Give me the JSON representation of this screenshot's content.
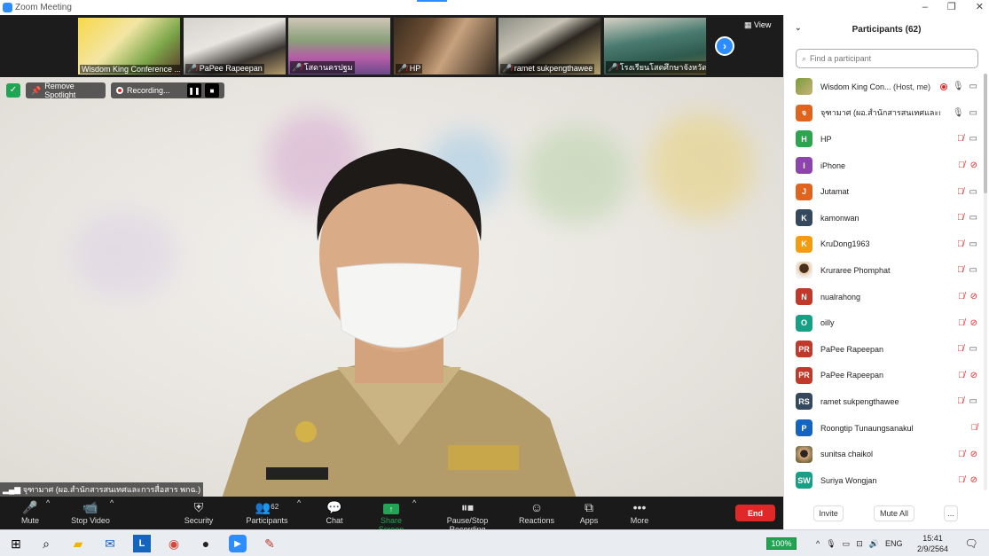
{
  "window": {
    "title": "Zoom Meeting",
    "controls": [
      "–",
      "❐",
      "✕"
    ]
  },
  "thumbnails": [
    {
      "name": "Wisdom King Conference ...",
      "muted": false
    },
    {
      "name": "PaPee Rapeepan",
      "muted": true
    },
    {
      "name": "โสดานครปฐม",
      "muted": true
    },
    {
      "name": "HP",
      "muted": true
    },
    {
      "name": "ramet  sukpengthawee",
      "muted": true
    },
    {
      "name": "โรงเรียนโสตศึกษาจังหวัดน...",
      "muted": true
    }
  ],
  "view_label": "View",
  "main": {
    "remove_spotlight": "Remove Spotlight",
    "recording_label": "Recording...",
    "speaker_name": "จุฑามาศ (ผอ.สำนักสารสนเทศและการสื่อสาร พกฉ.)"
  },
  "toolbar": {
    "mute": "Mute",
    "stop_video": "Stop Video",
    "security": "Security",
    "participants": "Participants",
    "participants_count": "62",
    "chat": "Chat",
    "share_screen": "Share Screen",
    "pause_stop_recording": "Pause/Stop Recording",
    "reactions": "Reactions",
    "apps": "Apps",
    "more": "More",
    "end": "End"
  },
  "panel": {
    "title": "Participants (62)",
    "search_placeholder": "Find a participant",
    "participants": [
      {
        "initials": "",
        "avatar": "img",
        "color": "#7a9d3a",
        "name": "Wisdom King Con...",
        "role": "(Host, me)",
        "recording": true,
        "mic": "on",
        "cam": "on"
      },
      {
        "initials": "จ",
        "avatar": "letter",
        "color": "#e0641e",
        "name": "จุฑามาศ (ผอ.สำนักสารสนเทศและการ...",
        "role": "",
        "recording": false,
        "mic": "on",
        "cam": "on"
      },
      {
        "initials": "H",
        "avatar": "letter",
        "color": "#2ea44f",
        "name": "HP",
        "role": "",
        "recording": false,
        "mic": "off",
        "cam": "on"
      },
      {
        "initials": "I",
        "avatar": "letter",
        "color": "#8e44ad",
        "name": "iPhone",
        "role": "",
        "recording": false,
        "mic": "off",
        "cam": "off"
      },
      {
        "initials": "J",
        "avatar": "letter",
        "color": "#e0641e",
        "name": "Jutamat",
        "role": "",
        "recording": false,
        "mic": "off",
        "cam": "on"
      },
      {
        "initials": "K",
        "avatar": "letter",
        "color": "#34495e",
        "name": "kamonwan",
        "role": "",
        "recording": false,
        "mic": "off",
        "cam": "on"
      },
      {
        "initials": "K",
        "avatar": "letter",
        "color": "#f39c12",
        "name": "KruDong1963",
        "role": "",
        "recording": false,
        "mic": "off",
        "cam": "on"
      },
      {
        "initials": "",
        "avatar": "photo",
        "color": "#ffffff",
        "name": "Kruraree Phomphat",
        "role": "",
        "recording": false,
        "mic": "off",
        "cam": "on"
      },
      {
        "initials": "N",
        "avatar": "letter",
        "color": "#c0392b",
        "name": "nualrahong",
        "role": "",
        "recording": false,
        "mic": "off",
        "cam": "off"
      },
      {
        "initials": "O",
        "avatar": "letter",
        "color": "#16a085",
        "name": "oilly",
        "role": "",
        "recording": false,
        "mic": "off",
        "cam": "off"
      },
      {
        "initials": "PR",
        "avatar": "letter",
        "color": "#c0392b",
        "name": "PaPee Rapeepan",
        "role": "",
        "recording": false,
        "mic": "off",
        "cam": "on"
      },
      {
        "initials": "PR",
        "avatar": "letter",
        "color": "#c0392b",
        "name": "PaPee Rapeepan",
        "role": "",
        "recording": false,
        "mic": "off",
        "cam": "off"
      },
      {
        "initials": "RS",
        "avatar": "letter",
        "color": "#34495e",
        "name": "ramet  sukpengthawee",
        "role": "",
        "recording": false,
        "mic": "off",
        "cam": "on"
      },
      {
        "initials": "P",
        "avatar": "letter",
        "color": "#1565c0",
        "name": "Roongtip Tunaungsanakul",
        "role": "",
        "recording": false,
        "mic": "off",
        "cam": "none"
      },
      {
        "initials": "",
        "avatar": "photo2",
        "color": "#7a6b3e",
        "name": "sunitsa chaikol",
        "role": "",
        "recording": false,
        "mic": "off",
        "cam": "off"
      },
      {
        "initials": "SW",
        "avatar": "letter",
        "color": "#16a085",
        "name": "Suriya Wongjan",
        "role": "",
        "recording": false,
        "mic": "off",
        "cam": "off"
      }
    ],
    "invite": "Invite",
    "mute_all": "Mute All",
    "more": "..."
  },
  "taskbar": {
    "battery": "100%",
    "lang": "ENG",
    "time": "15:41",
    "date": "2/9/2564"
  },
  "colors": {
    "accent": "#2d8cff",
    "end": "#e02828",
    "share": "#23a455"
  }
}
